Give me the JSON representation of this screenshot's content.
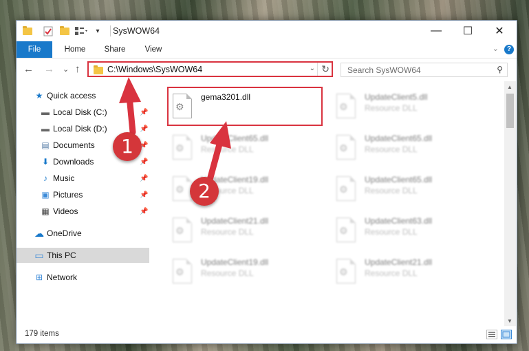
{
  "window": {
    "title": "SysWOW64",
    "controls": {
      "minimize": "—",
      "maximize": "☐",
      "close": "✕"
    }
  },
  "ribbon": {
    "tabs": [
      "File",
      "Home",
      "Share",
      "View"
    ],
    "help": "?",
    "collapse": "⌄"
  },
  "nav_buttons": {
    "back": "←",
    "forward": "→",
    "recent": "⌄",
    "up": "↑"
  },
  "address": {
    "path": "C:\\Windows\\SysWOW64",
    "dropdown": "⌄",
    "refresh": "↻"
  },
  "search": {
    "placeholder": "Search SysWOW64",
    "icon": "⚲"
  },
  "nav_pane": {
    "items": [
      {
        "label": "Quick access",
        "icon": "★"
      },
      {
        "label": "Local Disk (C:)",
        "icon": "▬",
        "pin": "📌"
      },
      {
        "label": "Local Disk (D:)",
        "icon": "▬",
        "pin": "📌"
      },
      {
        "label": "Documents",
        "icon": "▤",
        "pin": "📌"
      },
      {
        "label": "Downloads",
        "icon": "⬇",
        "pin": "📌"
      },
      {
        "label": "Music",
        "icon": "♪",
        "pin": "📌"
      },
      {
        "label": "Pictures",
        "icon": "▣",
        "pin": "📌"
      },
      {
        "label": "Videos",
        "icon": "▦",
        "pin": "📌"
      },
      {
        "label": "OneDrive",
        "icon": "☁"
      },
      {
        "label": "This PC",
        "icon": "▭"
      },
      {
        "label": "Network",
        "icon": "⊞"
      }
    ]
  },
  "files": [
    {
      "name": "gema3201.dll",
      "type": ""
    },
    {
      "name": "UpdateClient5.dll",
      "type": "Resource DLL"
    },
    {
      "name": "UpdateClient65.dll",
      "type": "Resource DLL"
    },
    {
      "name": "UpdateClient65.dll",
      "type": "Resource DLL"
    },
    {
      "name": "UpdateClient19.dll",
      "type": "Resource DLL"
    },
    {
      "name": "UpdateClient65.dll",
      "type": "Resource DLL"
    },
    {
      "name": "UpdateClient21.dll",
      "type": "Resource DLL"
    },
    {
      "name": "UpdateClient63.dll",
      "type": "Resource DLL"
    },
    {
      "name": "UpdateClient19.dll",
      "type": "Resource DLL"
    },
    {
      "name": "UpdateClient21.dll",
      "type": "Resource DLL"
    }
  ],
  "status": {
    "item_count": "179 items"
  },
  "annotations": {
    "step1": "1",
    "step2": "2",
    "color": "#d9333f"
  }
}
